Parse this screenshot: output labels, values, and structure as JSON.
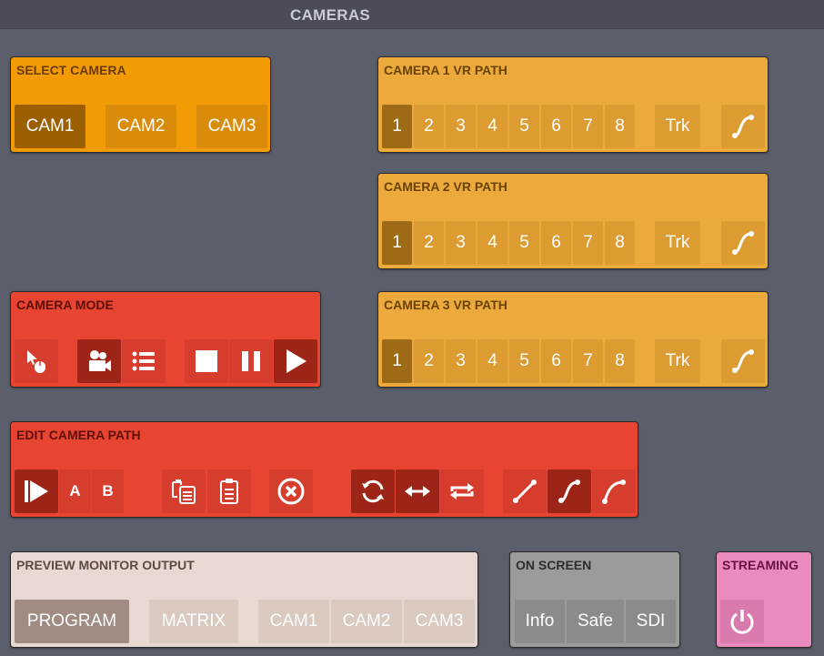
{
  "header": {
    "title": "CAMERAS"
  },
  "select_camera": {
    "label": "SELECT CAMERA",
    "buttons": [
      "CAM1",
      "CAM2",
      "CAM3"
    ],
    "active_index": 0
  },
  "vr_paths": [
    {
      "label": "CAMERA 1 VR PATH",
      "paths": [
        "1",
        "2",
        "3",
        "4",
        "5",
        "6",
        "7",
        "8"
      ],
      "track": "Trk",
      "active_index": 0
    },
    {
      "label": "CAMERA 2 VR PATH",
      "paths": [
        "1",
        "2",
        "3",
        "4",
        "5",
        "6",
        "7",
        "8"
      ],
      "track": "Trk",
      "active_index": 0
    },
    {
      "label": "CAMERA 3 VR PATH",
      "paths": [
        "1",
        "2",
        "3",
        "4",
        "5",
        "6",
        "7",
        "8"
      ],
      "track": "Trk",
      "active_index": 0
    }
  ],
  "camera_mode": {
    "label": "CAMERA MODE",
    "icons": [
      "mouse-icon",
      "video-camera-icon",
      "list-icon",
      "stop-icon",
      "pause-icon",
      "play-icon"
    ]
  },
  "edit_path": {
    "label": "EDIT CAMERA PATH",
    "a_label": "A",
    "b_label": "B",
    "icons": [
      "play-to-end-icon",
      "copy-icon",
      "paste-icon",
      "delete-icon",
      "loop-icon",
      "bounce-icon",
      "repeat-icon",
      "linear-curve-icon",
      "s-curve-icon",
      "ease-curve-icon"
    ]
  },
  "preview": {
    "label": "PREVIEW MONITOR OUTPUT",
    "program": "PROGRAM",
    "matrix": "MATRIX",
    "cams": [
      "CAM1",
      "CAM2",
      "CAM3"
    ]
  },
  "on_screen": {
    "label": "ON SCREEN",
    "buttons": [
      "Info",
      "Safe",
      "SDI"
    ]
  },
  "streaming": {
    "label": "STREAMING",
    "icon": "power-icon"
  },
  "colors": {
    "background": "#5b5f6b",
    "select_orange": "#f29b05",
    "vr_orange": "#edaa3c",
    "red": "#e74432",
    "preview": "#e7d9d1",
    "on_screen": "#9b9b9b",
    "streaming": "#e98bbd"
  }
}
